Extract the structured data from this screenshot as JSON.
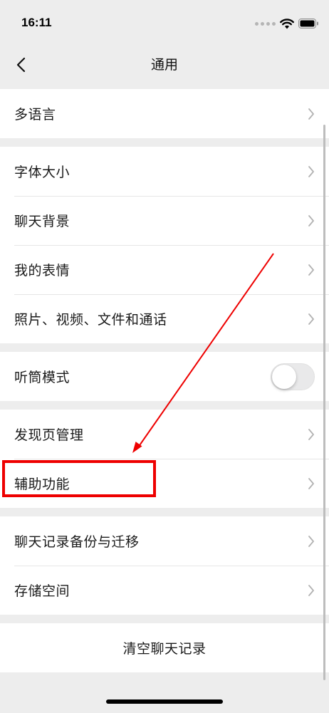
{
  "status_bar": {
    "time": "16:11"
  },
  "nav": {
    "title": "通用"
  },
  "groups": [
    {
      "items": [
        {
          "label": "多语言"
        }
      ]
    },
    {
      "items": [
        {
          "label": "字体大小"
        },
        {
          "label": "聊天背景"
        },
        {
          "label": "我的表情"
        },
        {
          "label": "照片、视频、文件和通话"
        }
      ]
    },
    {
      "items": [
        {
          "label": "听筒模式",
          "toggle": false
        }
      ]
    },
    {
      "items": [
        {
          "label": "发现页管理"
        },
        {
          "label": "辅助功能",
          "highlighted": true
        }
      ]
    },
    {
      "items": [
        {
          "label": "聊天记录备份与迁移"
        },
        {
          "label": "存储空间"
        }
      ]
    }
  ],
  "clear_chat": {
    "label": "清空聊天记录"
  },
  "colors": {
    "annotation": "#ee0000",
    "background": "#ededed",
    "card": "#ffffff",
    "chevron": "#b2b2b2"
  }
}
